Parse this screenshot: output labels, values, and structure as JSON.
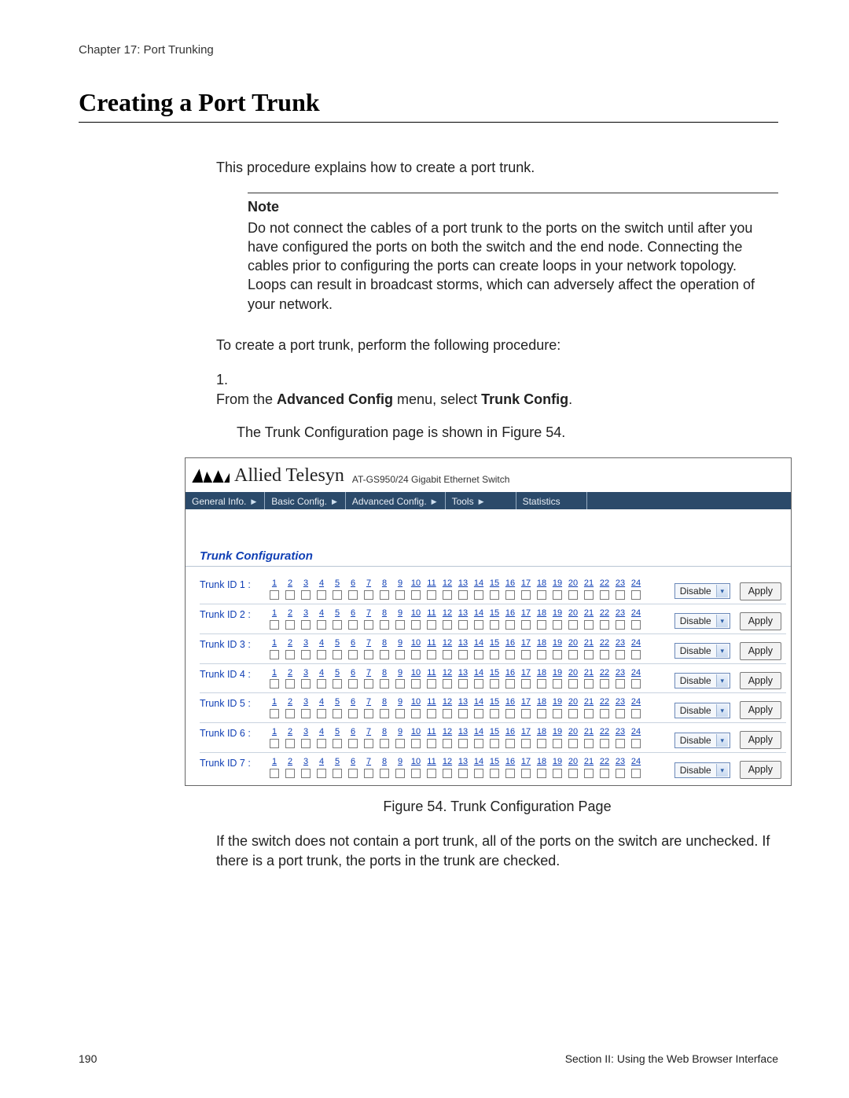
{
  "header": {
    "chapter": "Chapter 17: Port Trunking"
  },
  "title": "Creating a Port Trunk",
  "intro": "This procedure explains how to create a port trunk.",
  "note": {
    "label": "Note",
    "body": "Do not connect the cables of a port trunk to the ports on the switch until after you have configured the ports on both the switch and the end node. Connecting the cables prior to configuring the ports can create loops in your network topology. Loops can result in broadcast storms, which can adversely affect the operation of your network."
  },
  "lead_in": "To create a port trunk, perform the following procedure:",
  "step1": {
    "num": "1.",
    "pre": "From the ",
    "b1": "Advanced Config",
    "mid": " menu, select ",
    "b2": "Trunk Config",
    "post": "."
  },
  "step1_after": "The Trunk Configuration page is shown in Figure 54.",
  "figure_caption": "Figure 54. Trunk Configuration Page",
  "after_figure": "If the switch does not contain a port trunk, all of the ports on the switch are unchecked. If there is a port trunk, the ports in the trunk are checked.",
  "footer": {
    "page": "190",
    "section": "Section II: Using the Web Browser Interface"
  },
  "ui": {
    "brand": "Allied Telesyn",
    "model": "AT-GS950/24 Gigabit Ethernet Switch",
    "menu": [
      "General Info.",
      "Basic Config.",
      "Advanced Config.",
      "Tools",
      "Statistics"
    ],
    "section_title": "Trunk Configuration",
    "port_numbers": [
      "1",
      "2",
      "3",
      "4",
      "5",
      "6",
      "7",
      "8",
      "9",
      "10",
      "11",
      "12",
      "13",
      "14",
      "15",
      "16",
      "17",
      "18",
      "19",
      "20",
      "21",
      "22",
      "23",
      "24"
    ],
    "select_value": "Disable",
    "apply_label": "Apply",
    "trunks": [
      {
        "label": "Trunk ID 1 :"
      },
      {
        "label": "Trunk ID 2 :"
      },
      {
        "label": "Trunk ID 3 :"
      },
      {
        "label": "Trunk ID 4 :"
      },
      {
        "label": "Trunk ID 5 :"
      },
      {
        "label": "Trunk ID 6 :"
      },
      {
        "label": "Trunk ID 7 :"
      }
    ]
  }
}
